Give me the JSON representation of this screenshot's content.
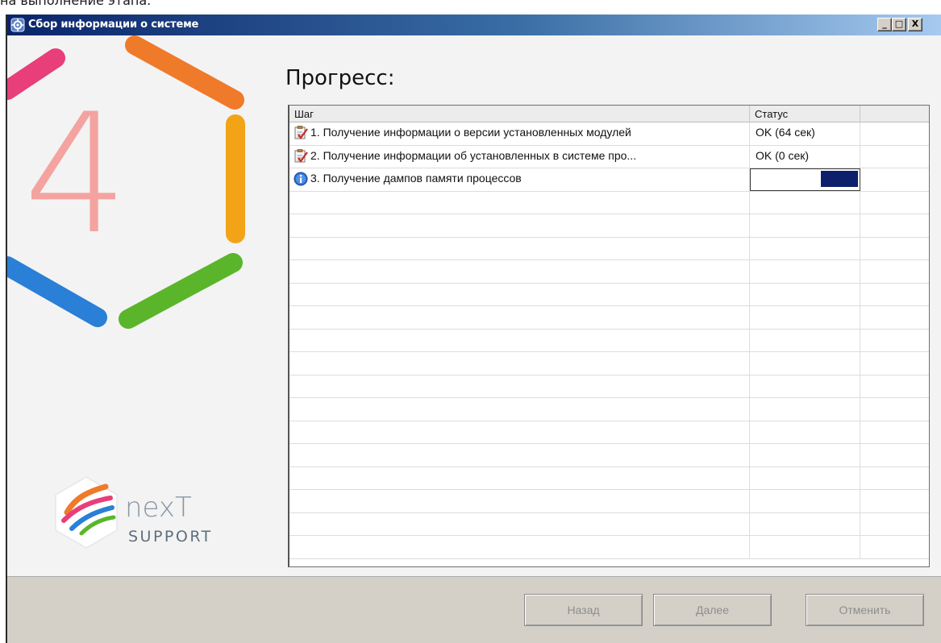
{
  "caption_fragment": "на выполнение этапа.",
  "window": {
    "title": "Сбор информации о системе",
    "controls": {
      "minimize": "_",
      "maximize": "□",
      "close": "X"
    }
  },
  "branding": {
    "big_number": "4",
    "logo_word": "nexT",
    "logo_sub": "SUPPORT",
    "colors": {
      "orange": "#ef7a2a",
      "yellow": "#f3a316",
      "green": "#5bb52a",
      "blue": "#2a7fd6",
      "magenta": "#e83e7a",
      "number": "#f4a3a0"
    }
  },
  "heading": "Прогресс:",
  "table": {
    "columns": [
      "Шаг",
      "Статус",
      ""
    ],
    "rows": [
      {
        "icon": "checklist-icon",
        "step": "1. Получение информации о версии установленных модулей",
        "status": "OK (64 сек)"
      },
      {
        "icon": "checklist-icon",
        "step": "2. Получение информации об установленных в системе про...",
        "status": "OK (0 сек)"
      },
      {
        "icon": "info-icon",
        "step": "3. Получение дампов памяти процессов",
        "status": "",
        "progress": 0.33
      }
    ],
    "empty_rows": 16
  },
  "buttons": {
    "back": "Назад",
    "next": "Далее",
    "cancel": "Отменить"
  }
}
